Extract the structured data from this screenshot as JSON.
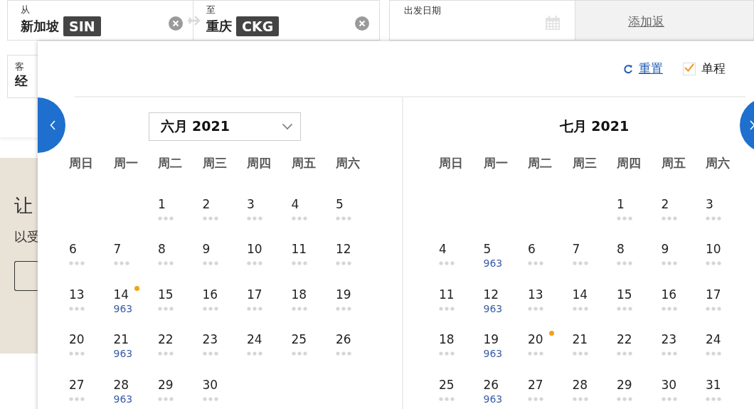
{
  "search": {
    "from": {
      "label": "从",
      "city": "新加坡",
      "code": "SIN"
    },
    "to": {
      "label": "至",
      "city": "重庆",
      "code": "CKG"
    },
    "depart": {
      "label": "出发日期"
    },
    "add_return": "添加返",
    "cabin": {
      "label": "客",
      "value": "经"
    }
  },
  "background": {
    "heading": "让",
    "text": "以受"
  },
  "picker": {
    "reset": "重置",
    "one_way": {
      "label": "单程",
      "checked": true
    },
    "months": [
      {
        "title": "六月 2021",
        "kind": "select",
        "weekdays": [
          "周日",
          "周一",
          "周二",
          "周三",
          "周四",
          "周五",
          "周六"
        ],
        "weeks": [
          {
            "kind": "first",
            "days": [
              {
                "day": "1",
                "marked": false
              },
              {
                "day": "2",
                "marked": false
              },
              {
                "day": "3",
                "marked": false
              },
              {
                "day": "4",
                "marked": false
              },
              {
                "day": "5",
                "marked": false
              }
            ]
          },
          [
            {
              "day": "6",
              "marked": false
            },
            {
              "day": "7",
              "marked": false
            },
            {
              "day": "8",
              "marked": false
            },
            {
              "day": "9",
              "marked": false
            },
            {
              "day": "10",
              "marked": false
            },
            {
              "day": "11",
              "marked": false
            },
            {
              "day": "12",
              "marked": false
            }
          ],
          [
            {
              "day": "13",
              "marked": false
            },
            {
              "day": "14",
              "price": "963",
              "marked": true
            },
            {
              "day": "15",
              "marked": false
            },
            {
              "day": "16",
              "marked": false
            },
            {
              "day": "17",
              "marked": false
            },
            {
              "day": "18",
              "marked": false
            },
            {
              "day": "19",
              "marked": false
            }
          ],
          [
            {
              "day": "20",
              "marked": false
            },
            {
              "day": "21",
              "price": "963",
              "marked": false
            },
            {
              "day": "22",
              "marked": false
            },
            {
              "day": "23",
              "marked": false
            },
            {
              "day": "24",
              "marked": false
            },
            {
              "day": "25",
              "marked": false
            },
            {
              "day": "26",
              "marked": false
            }
          ],
          [
            {
              "day": "27",
              "marked": false
            },
            {
              "day": "28",
              "price": "963",
              "marked": false
            },
            {
              "day": "29",
              "marked": false
            },
            {
              "day": "30",
              "marked": false
            }
          ]
        ]
      },
      {
        "title": "七月 2021",
        "kind": "label",
        "weekdays": [
          "周日",
          "周一",
          "周二",
          "周三",
          "周四",
          "周五",
          "周六"
        ],
        "weeks": [
          {
            "kind": "first",
            "days": [
              {
                "day": "1",
                "marked": false
              },
              {
                "day": "2",
                "marked": false
              },
              {
                "day": "3",
                "marked": false
              }
            ]
          },
          [
            {
              "day": "4",
              "marked": false
            },
            {
              "day": "5",
              "price": "963",
              "marked": false
            },
            {
              "day": "6",
              "marked": false
            },
            {
              "day": "7",
              "marked": false
            },
            {
              "day": "8",
              "marked": false
            },
            {
              "day": "9",
              "marked": false
            },
            {
              "day": "10",
              "marked": false
            }
          ],
          [
            {
              "day": "11",
              "marked": false
            },
            {
              "day": "12",
              "price": "963",
              "marked": false
            },
            {
              "day": "13",
              "marked": false
            },
            {
              "day": "14",
              "marked": false
            },
            {
              "day": "15",
              "marked": false
            },
            {
              "day": "16",
              "marked": false
            },
            {
              "day": "17",
              "marked": false
            }
          ],
          [
            {
              "day": "18",
              "marked": false
            },
            {
              "day": "19",
              "price": "963",
              "marked": false
            },
            {
              "day": "20",
              "marked": true
            },
            {
              "day": "21",
              "marked": false
            },
            {
              "day": "22",
              "marked": false
            },
            {
              "day": "23",
              "marked": false
            },
            {
              "day": "24",
              "marked": false
            }
          ],
          [
            {
              "day": "25",
              "marked": false
            },
            {
              "day": "26",
              "price": "963",
              "marked": false
            },
            {
              "day": "27",
              "marked": false
            },
            {
              "day": "28",
              "marked": false
            },
            {
              "day": "29",
              "marked": false
            },
            {
              "day": "30",
              "marked": false
            },
            {
              "day": "31",
              "marked": false
            }
          ]
        ]
      }
    ]
  }
}
